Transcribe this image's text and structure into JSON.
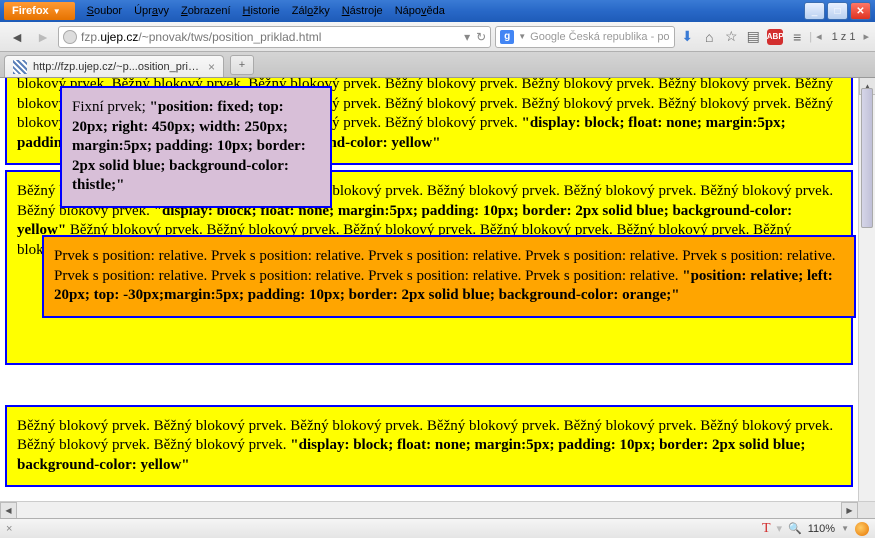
{
  "titlebar": {
    "firefox_label": "Firefox"
  },
  "menu": {
    "items": [
      "Soubor",
      "Úpravy",
      "Zobrazení",
      "Historie",
      "Záložky",
      "Nástroje",
      "Nápověda"
    ]
  },
  "url": {
    "prefix": "fzp.",
    "domain": "ujep.cz",
    "path": "/~pnovak/tws/position_priklad.html"
  },
  "search": {
    "placeholder": "Google Česká republika - po"
  },
  "page_counter": "1 z 1",
  "tab": {
    "title": "http://fzp.ujep.cz/~p...osition_priklad.html"
  },
  "content": {
    "block1": "blokový prvek. Běžný blokový prvek. Běžný blokový prvek. Běžný blokový prvek. Běžný blokový prvek. Běžný blokový prvek. Běžný blokový prvek. Běžný blokový prvek. Běžný blokový prvek. Běžný blokový prvek. Běžný blokový prvek. Běžný blokový prvek. Běžný blokový prvek. Běžný blokový prvek. Běžný blokový prvek. Běžný blokový prvek. ",
    "block1_code": "\"display: block; float: none; margin:5px; padding: 10px; border: 2px solid blue; background-color: yellow\"",
    "block2": "Běžný blokový prvek. Běžný blokový prvek. Běžný blokový prvek. Běžný blokový prvek. Běžný blokový prvek. Běžný blokový prvek. Běžný blokový prvek. ",
    "block2_code": "\"display: block; float: none; margin:5px; padding: 10px; border: 2px solid blue; background-color: yellow\" ",
    "block2_tail": "Běžný blokový prvek. Běžný blokový prvek. Běžný blokový prvek. Běžný blokový prvek. Běžný blokový prvek. Běžný blokový prvek. Běžný blokový prvek.",
    "relative": "Prvek s position: relative. Prvek s position: relative. Prvek s position: relative. Prvek s position: relative. Prvek s position: relative. Prvek s position: relative. Prvek s position: relative. Prvek s position: relative. Prvek s position: relative. ",
    "relative_code": "\"position: relative; left: 20px; top: -30px;margin:5px; padding: 10px; border: 2px solid blue; background-color: orange;\"",
    "fixed": "Fixní prvek; ",
    "fixed_code": "\"position: fixed; top: 20px; right: 450px; width: 250px; margin:5px; padding: 10px; border: 2px solid blue; background-color: thistle;\"",
    "block3": "Běžný blokový prvek. Běžný blokový prvek. Běžný blokový prvek. Běžný blokový prvek. Běžný blokový prvek. Běžný blokový prvek. Běžný blokový prvek. Běžný blokový prvek. ",
    "block3_code": "\"display: block; float: none; margin:5px; padding: 10px; border: 2px solid blue; background-color: yellow\""
  },
  "status": {
    "zoom": "110%"
  }
}
